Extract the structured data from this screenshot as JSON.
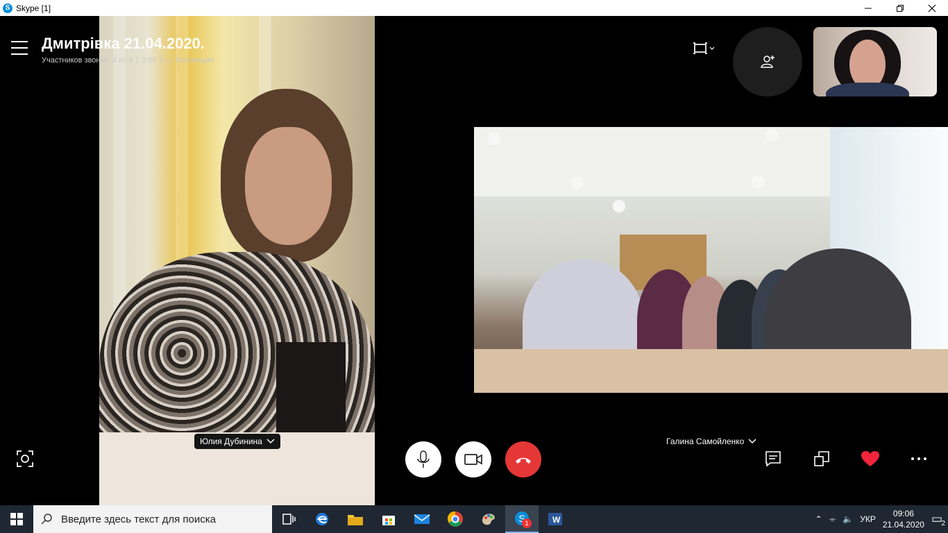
{
  "window": {
    "title": "Skype [1]",
    "controls": [
      "minimize-icon",
      "restore-icon",
      "close-icon"
    ]
  },
  "call": {
    "title": "Дмитрівка 21.04.2020.",
    "participants": "Участников звонка: 3 из 4",
    "separator": "|",
    "duration": "2:05",
    "separator2": "|",
    "collection": "Коллекция",
    "left_participant": "Юлия Дубинина",
    "right_participant": "Галина Самойленко"
  },
  "buttons": {
    "menu": "menu-icon",
    "screen_view": "screen-view-icon",
    "add_person": "add-person-icon",
    "snapshot": "camera-snapshot-icon",
    "mic": "microphone-icon",
    "video": "video-camera-icon",
    "end_call": "end-call-icon",
    "chat": "chat-icon",
    "switch": "switch-layout-icon",
    "react": "heart-icon",
    "more": "more-options-icon"
  },
  "taskbar": {
    "search_placeholder": "Введите здесь текст для поиска",
    "apps": [
      "task-view-icon",
      "edge-icon",
      "file-explorer-icon",
      "store-icon",
      "mail-icon",
      "chrome-icon",
      "paint-icon",
      "skype-icon",
      "word-icon"
    ],
    "skype_badge": "1",
    "language": "УКР",
    "time": "09:06",
    "date": "21.04.2020",
    "notifications": "2"
  },
  "colors": {
    "end_call": "#e63737",
    "heart": "#f0253b",
    "taskbar": "#1f2732",
    "skype_blue": "#0a8ed9"
  }
}
